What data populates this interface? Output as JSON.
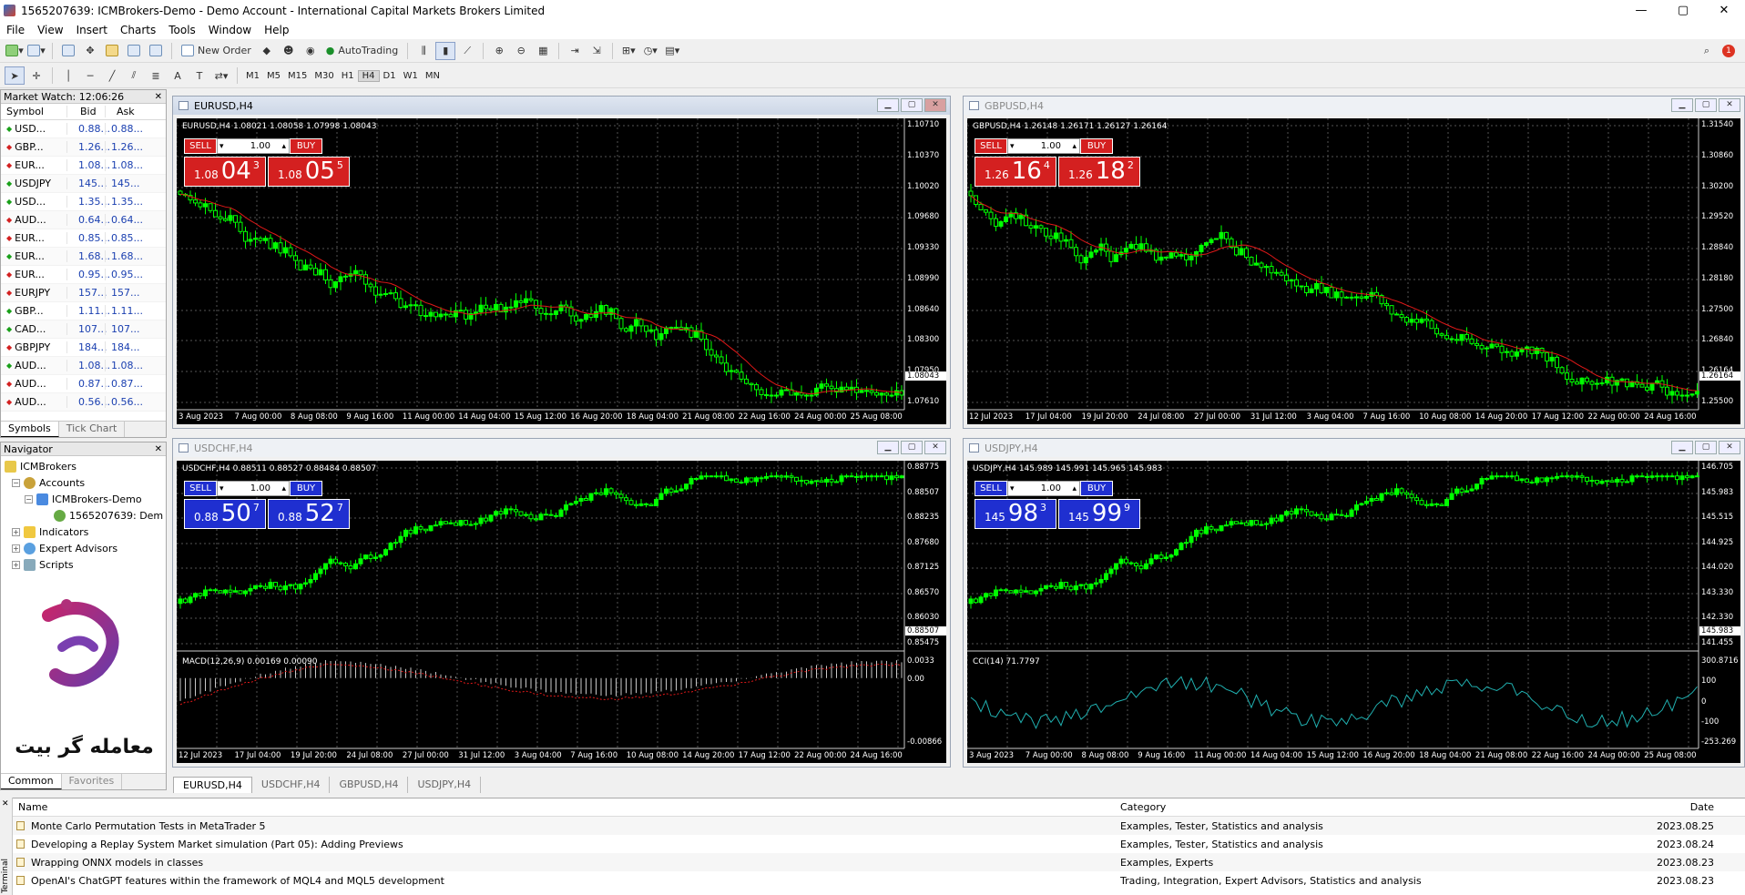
{
  "window": {
    "title": "1565207639: ICMBrokers-Demo - Demo Account - International Capital Markets Brokers Limited"
  },
  "menu": [
    "File",
    "View",
    "Insert",
    "Charts",
    "Tools",
    "Window",
    "Help"
  ],
  "toolbar": {
    "new_order": "New Order",
    "autotrading": "AutoTrading",
    "notif_count": "1"
  },
  "timeframes": [
    "M1",
    "M5",
    "M15",
    "M30",
    "H1",
    "H4",
    "D1",
    "W1",
    "MN"
  ],
  "active_timeframe": "H4",
  "market_watch": {
    "title": "Market Watch: 12:06:26",
    "headers": {
      "symbol": "Symbol",
      "bid": "Bid",
      "ask": "Ask"
    },
    "rows": [
      {
        "symbol": "USD...",
        "bid": "0.88...",
        "ask": "0.88...",
        "dir": "up"
      },
      {
        "symbol": "GBP...",
        "bid": "1.26...",
        "ask": "1.26...",
        "dir": "down"
      },
      {
        "symbol": "EUR...",
        "bid": "1.08...",
        "ask": "1.08...",
        "dir": "down"
      },
      {
        "symbol": "USDJPY",
        "bid": "145...",
        "ask": "145...",
        "dir": "up"
      },
      {
        "symbol": "USD...",
        "bid": "1.35...",
        "ask": "1.35...",
        "dir": "up"
      },
      {
        "symbol": "AUD...",
        "bid": "0.64...",
        "ask": "0.64...",
        "dir": "down"
      },
      {
        "symbol": "EUR...",
        "bid": "0.85...",
        "ask": "0.85...",
        "dir": "down"
      },
      {
        "symbol": "EUR...",
        "bid": "1.68...",
        "ask": "1.68...",
        "dir": "up"
      },
      {
        "symbol": "EUR...",
        "bid": "0.95...",
        "ask": "0.95...",
        "dir": "down"
      },
      {
        "symbol": "EURJPY",
        "bid": "157...",
        "ask": "157...",
        "dir": "down"
      },
      {
        "symbol": "GBP...",
        "bid": "1.11...",
        "ask": "1.11...",
        "dir": "up"
      },
      {
        "symbol": "CAD...",
        "bid": "107...",
        "ask": "107...",
        "dir": "up"
      },
      {
        "symbol": "GBPJPY",
        "bid": "184...",
        "ask": "184...",
        "dir": "down"
      },
      {
        "symbol": "AUD...",
        "bid": "1.08...",
        "ask": "1.08...",
        "dir": "up"
      },
      {
        "symbol": "AUD...",
        "bid": "0.87...",
        "ask": "0.87...",
        "dir": "down"
      },
      {
        "symbol": "AUD...",
        "bid": "0.56...",
        "ask": "0.56...",
        "dir": "down"
      }
    ],
    "tabs": [
      "Symbols",
      "Tick Chart"
    ]
  },
  "navigator": {
    "title": "Navigator",
    "root": "ICMBrokers",
    "accounts": "Accounts",
    "server": "ICMBrokers-Demo",
    "account": "1565207639: Dem",
    "indicators": "Indicators",
    "experts": "Expert Advisors",
    "scripts": "Scripts",
    "logo_text": "معامله گر بیت",
    "tabs": [
      "Common",
      "Favorites"
    ]
  },
  "charts": {
    "eurusd": {
      "title": "EURUSD,H4",
      "info": "EURUSD,H4  1.08021 1.08058 1.07998 1.08043",
      "sell_small": "1.08",
      "sell_big": "04",
      "sell_sup": "3",
      "buy_small": "1.08",
      "buy_big": "05",
      "buy_sup": "5",
      "lot": "1.00",
      "sell": "SELL",
      "buy": "BUY",
      "color": "#d42020",
      "yticks": [
        "1.10710",
        "1.10370",
        "1.10020",
        "1.09680",
        "1.09330",
        "1.08990",
        "1.08640",
        "1.08300",
        "1.07950",
        "1.07610"
      ],
      "cur": "1.08043",
      "xticks": [
        "3 Aug 2023",
        "7 Aug 00:00",
        "8 Aug 08:00",
        "9 Aug 16:00",
        "11 Aug 00:00",
        "14 Aug 04:00",
        "15 Aug 12:00",
        "16 Aug 20:00",
        "18 Aug 04:00",
        "21 Aug 08:00",
        "22 Aug 16:00",
        "24 Aug 00:00",
        "25 Aug 08:00"
      ]
    },
    "gbpusd": {
      "title": "GBPUSD,H4",
      "info": "GBPUSD,H4  1.26148 1.26171 1.26127 1.26164",
      "sell_small": "1.26",
      "sell_big": "16",
      "sell_sup": "4",
      "buy_small": "1.26",
      "buy_big": "18",
      "buy_sup": "2",
      "lot": "1.00",
      "sell": "SELL",
      "buy": "BUY",
      "color": "#d42020",
      "yticks": [
        "1.31540",
        "1.30860",
        "1.30200",
        "1.29520",
        "1.28840",
        "1.28180",
        "1.27500",
        "1.26840",
        "1.26164",
        "1.25500"
      ],
      "cur": "1.26164",
      "xticks": [
        "12 Jul 2023",
        "17 Jul 04:00",
        "19 Jul 20:00",
        "24 Jul 08:00",
        "27 Jul 00:00",
        "31 Jul 12:00",
        "3 Aug 04:00",
        "7 Aug 16:00",
        "10 Aug 08:00",
        "14 Aug 20:00",
        "17 Aug 12:00",
        "22 Aug 00:00",
        "24 Aug 16:00"
      ]
    },
    "usdchf": {
      "title": "USDCHF,H4",
      "info": "USDCHF,H4  0.88511 0.88527 0.88484 0.88507",
      "sell_small": "0.88",
      "sell_big": "50",
      "sell_sup": "7",
      "buy_small": "0.88",
      "buy_big": "52",
      "buy_sup": "7",
      "lot": "1.00",
      "sell": "SELL",
      "buy": "BUY",
      "color": "#1f2fd0",
      "yticks": [
        "0.88775",
        "0.88507",
        "0.88235",
        "0.87680",
        "0.87125",
        "0.86570",
        "0.86030",
        "0.85475"
      ],
      "cur": "0.88507",
      "macd_label": "MACD(12,26,9) 0.00169 0.00090",
      "macd_ticks": [
        "0.0033",
        "0.00",
        "-0.00866"
      ],
      "xticks": [
        "12 Jul 2023",
        "17 Jul 04:00",
        "19 Jul 20:00",
        "24 Jul 08:00",
        "27 Jul 00:00",
        "31 Jul 12:00",
        "3 Aug 04:00",
        "7 Aug 16:00",
        "10 Aug 08:00",
        "14 Aug 20:00",
        "17 Aug 12:00",
        "22 Aug 00:00",
        "24 Aug 16:00"
      ]
    },
    "usdjpy": {
      "title": "USDJPY,H4",
      "info": "USDJPY,H4  145.989 145.991 145.965 145.983",
      "sell_small": "145",
      "sell_big": "98",
      "sell_sup": "3",
      "buy_small": "145",
      "buy_big": "99",
      "buy_sup": "9",
      "lot": "1.00",
      "sell": "SELL",
      "buy": "BUY",
      "color": "#1f2fd0",
      "yticks": [
        "146.705",
        "145.983",
        "145.515",
        "144.925",
        "144.020",
        "143.330",
        "142.330",
        "141.455"
      ],
      "cur": "145.983",
      "cci_label": "CCI(14) 71.7797",
      "cci_ticks": [
        "300.8716",
        "100",
        "0",
        "-100",
        "-253.269"
      ],
      "xticks": [
        "3 Aug 2023",
        "7 Aug 00:00",
        "8 Aug 08:00",
        "9 Aug 16:00",
        "11 Aug 00:00",
        "14 Aug 04:00",
        "15 Aug 12:00",
        "16 Aug 20:00",
        "18 Aug 04:00",
        "21 Aug 08:00",
        "22 Aug 16:00",
        "24 Aug 00:00",
        "25 Aug 08:00"
      ]
    }
  },
  "chart_tabs": [
    "EURUSD,H4",
    "USDCHF,H4",
    "GBPUSD,H4",
    "USDJPY,H4"
  ],
  "terminal": {
    "side_label": "Terminal",
    "headers": {
      "name": "Name",
      "category": "Category",
      "date": "Date"
    },
    "rows": [
      {
        "name": "Monte Carlo Permutation Tests in MetaTrader 5",
        "category": "Examples, Tester, Statistics and analysis",
        "date": "2023.08.25"
      },
      {
        "name": "Developing a Replay System  Market simulation (Part 05): Adding Previews",
        "category": "Examples, Tester, Statistics and analysis",
        "date": "2023.08.24"
      },
      {
        "name": "Wrapping ONNX models in classes",
        "category": "Examples, Experts",
        "date": "2023.08.23"
      },
      {
        "name": "OpenAI's ChatGPT features within the framework of MQL4 and MQL5 development",
        "category": "Trading, Integration, Expert Advisors, Statistics and analysis",
        "date": "2023.08.23"
      }
    ]
  }
}
